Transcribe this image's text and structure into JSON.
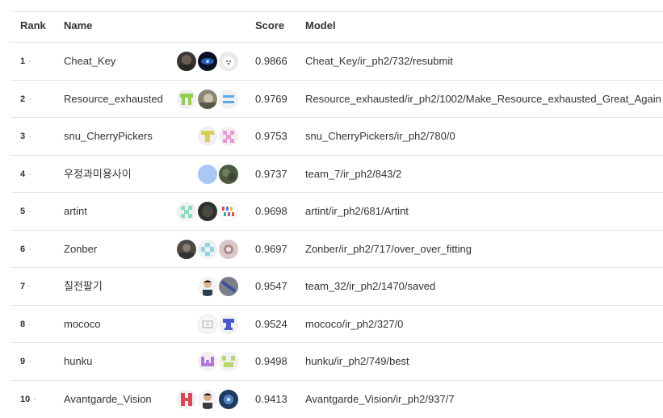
{
  "table": {
    "headers": {
      "rank": "Rank",
      "name": "Name",
      "score": "Score",
      "model": "Model"
    },
    "rows": [
      {
        "rank": "1",
        "dash": "-",
        "name": "Cheat_Key",
        "score": "0.9866",
        "model": "Cheat_Key/ir_ph2/732/resubmit",
        "avatars": [
          "dark-photo-avatar",
          "dark-blue-glow-avatar",
          "white-dog-avatar"
        ]
      },
      {
        "rank": "2",
        "dash": "-",
        "name": "Resource_exhausted",
        "score": "0.9769",
        "model": "Resource_exhausted/ir_ph2/1002/Make_Resource_exhausted_Great_Again",
        "avatars": [
          "green-identicon-avatar",
          "photo-avatar",
          "blue-identicon-avatar"
        ]
      },
      {
        "rank": "3",
        "dash": "-",
        "name": "snu_CherryPickers",
        "score": "0.9753",
        "model": "snu_CherryPickers/ir_ph2/780/0",
        "avatars": [
          "yellow-identicon-avatar",
          "pink-identicon-avatar"
        ]
      },
      {
        "rank": "4",
        "dash": "-",
        "name": "우정과미용사이",
        "score": "0.9737",
        "model": "team_7/ir_ph2/843/2",
        "avatars": [
          "light-blue-avatar",
          "nature-photo-avatar"
        ]
      },
      {
        "rank": "5",
        "dash": "-",
        "name": "artint",
        "score": "0.9698",
        "model": "artint/ir_ph2/681/Artint",
        "avatars": [
          "teal-identicon-avatar",
          "dark-photo-avatar",
          "artint-logo-avatar"
        ]
      },
      {
        "rank": "6",
        "dash": "-",
        "name": "Zonber",
        "score": "0.9697",
        "model": "Zonber/ir_ph2/717/over_over_fitting",
        "avatars": [
          "photo-avatar",
          "teal-identicon-avatar",
          "photo-avatar"
        ]
      },
      {
        "rank": "7",
        "dash": "-",
        "name": "칠전팔기",
        "score": "0.9547",
        "model": "team_32/ir_ph2/1470/saved",
        "avatars": [
          "person-photo-avatar",
          "gray-slash-avatar"
        ]
      },
      {
        "rank": "8",
        "dash": "-",
        "name": "mococo",
        "score": "0.9524",
        "model": "mococo/ir_ph2/327/0",
        "avatars": [
          "gray-identicon-avatar",
          "indigo-identicon-avatar"
        ]
      },
      {
        "rank": "9",
        "dash": "-",
        "name": "hunku",
        "score": "0.9498",
        "model": "hunku/ir_ph2/749/best",
        "avatars": [
          "purple-identicon-avatar",
          "lime-identicon-avatar"
        ]
      },
      {
        "rank": "10",
        "dash": "-",
        "name": "Avantgarde_Vision",
        "score": "0.9413",
        "model": "Avantgarde_Vision/ir_ph2/937/7",
        "avatars": [
          "red-identicon-avatar",
          "person-photo-avatar",
          "blue-photo-avatar"
        ]
      }
    ]
  },
  "colors": {
    "text": "#333333",
    "divider": "#e6e6e6",
    "dash": "#bdbdbd"
  }
}
